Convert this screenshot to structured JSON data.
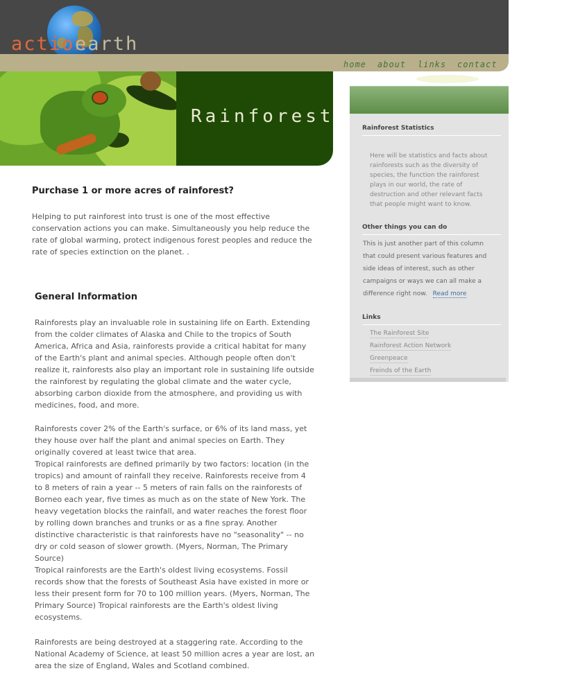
{
  "logo": {
    "part1": "action",
    "part2": "earth"
  },
  "nav": [
    "home",
    "about",
    "links",
    "contact"
  ],
  "banner": {
    "title": "Rainforest"
  },
  "main": {
    "heading1": "Purchase 1 or more acres of rainforest?",
    "intro": "Helping to put rainforest into trust is one of the most effective\nconservation actions you can make. Simultaneously you help reduce the\nrate of global warming, protect indigenous forest peoples and reduce the\nrate of species extinction on the planet. .",
    "heading2": "General Information",
    "para1": "Rainforests play an invaluable role in sustaining life on Earth. Extending\nfrom the colder climates of Alaska and Chile to the tropics of South\nAmerica, Africa and Asia, rainforests provide a critical habitat for many\nof the Earth's plant and animal species. Although people often don't\nrealize it, rainforests also play an important role in sustaining life outside\nthe rainforest by regulating the global climate and the water cycle,\nabsorbing carbon dioxide from the atmosphere, and providing us with\nmedicines, food, and more.",
    "para2": "Rainforests cover 2% of the Earth's surface, or 6% of its land mass, yet\nthey house over half the plant and animal species on Earth. They\noriginally covered at least twice that area.\nTropical rainforests are defined primarily by two factors: location (in the\ntropics) and amount of rainfall they receive. Rainforests receive from 4\nto 8 meters of rain a year -- 5 meters of rain falls on the rainforests of\nBorneo each year, five times as much as on the state of New York. The\nheavy vegetation blocks the rainfall, and water reaches the forest floor\nby rolling down branches and trunks or as a fine spray. Another\ndistinctive characteristic is that rainforests have no \"seasonality\" -- no\ndry or cold season of slower growth. (Myers, Norman, The Primary\nSource)\nTropical rainforests are the Earth's oldest living ecosystems. Fossil\nrecords show that the forests of Southeast Asia have existed in more or\nless their present form for 70 to 100 million years. (Myers, Norman, The\nPrimary Source) Tropical rainforests are the Earth's oldest living\necosystems.",
    "para3": "Rainforests are being destroyed at a staggering rate. According to the\nNational Academy of Science, at least 50 million acres a year are lost, an\narea the size of England, Wales and Scotland combined."
  },
  "sidebar": {
    "stats_heading": "Rainforest Statistics",
    "stats_text": "Here will be statistics and facts about\nrainforests such as the diversity of\nspecies, the function the rainforest\nplays in our world, the rate of\ndestruction and other relevant facts\nthat people might want to know.",
    "other_heading": "Other things you can do",
    "other_text": "This is just another part of this column\nthat could present various features and\nside ideas of interest, such as other\ncampaigns or ways we can all make a\ndifference right now.",
    "read_more": "Read more",
    "links_heading": "Links",
    "links": [
      "The Rainforest Site",
      "Rainforest Action Network",
      "Greenpeace",
      "Freinds of the Earth"
    ]
  }
}
